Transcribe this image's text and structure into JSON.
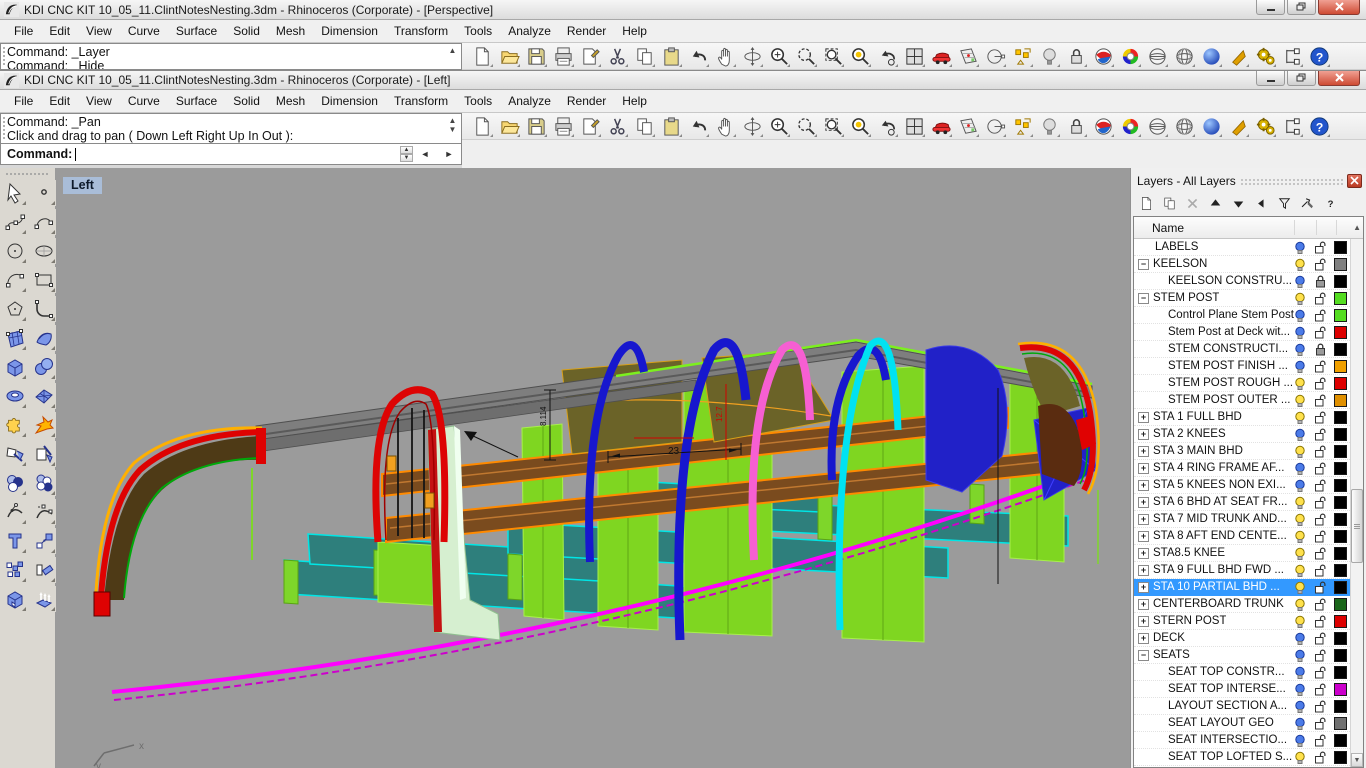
{
  "window1": {
    "title": "KDI CNC KIT 10_05_11.ClintNotesNesting.3dm - Rhinoceros (Corporate) - [Perspective]",
    "menus": [
      "File",
      "Edit",
      "View",
      "Curve",
      "Surface",
      "Solid",
      "Mesh",
      "Dimension",
      "Transform",
      "Tools",
      "Analyze",
      "Render",
      "Help"
    ],
    "command_history": [
      "Command: _Layer",
      "Command: _Hide"
    ]
  },
  "window2": {
    "title": "KDI CNC KIT 10_05_11.ClintNotesNesting.3dm - Rhinoceros (Corporate) - [Left]",
    "menus": [
      "File",
      "Edit",
      "View",
      "Curve",
      "Surface",
      "Solid",
      "Mesh",
      "Dimension",
      "Transform",
      "Tools",
      "Analyze",
      "Render",
      "Help"
    ],
    "command_history": [
      "Command: _Pan",
      "Click and drag to pan ( Down  Left  Right  Up  In  Out ):"
    ],
    "prompt_label": "Command:",
    "prompt_value": ""
  },
  "toolbar": {
    "icons": [
      {
        "name": "new-file",
        "label": "New"
      },
      {
        "name": "open-file",
        "label": "Open"
      },
      {
        "name": "save-file",
        "label": "Save"
      },
      {
        "name": "print",
        "label": "Print"
      },
      {
        "name": "page-setup",
        "label": "Page Setup"
      },
      {
        "name": "cut",
        "label": "Cut"
      },
      {
        "name": "copy",
        "label": "Copy"
      },
      {
        "name": "paste",
        "label": "Paste"
      },
      {
        "name": "undo",
        "label": "Undo"
      },
      {
        "name": "pan-view",
        "label": "Pan"
      },
      {
        "name": "rotate-view",
        "label": "Rotate View"
      },
      {
        "name": "zoom-dynamic",
        "label": "Zoom Dynamic"
      },
      {
        "name": "zoom-window",
        "label": "Zoom Window"
      },
      {
        "name": "zoom-target",
        "label": "Zoom Target"
      },
      {
        "name": "zoom-extents",
        "label": "Zoom Extents"
      },
      {
        "name": "undo-view",
        "label": "Undo View Change"
      },
      {
        "name": "viewport-layout",
        "label": "4 Viewports"
      },
      {
        "name": "car",
        "label": "Named View"
      },
      {
        "name": "cplane-map",
        "label": "CPlane Map"
      },
      {
        "name": "cplane-circle",
        "label": "Set CPlane"
      },
      {
        "name": "osnap",
        "label": "Object Snap"
      },
      {
        "name": "lamp",
        "label": "Lamp"
      },
      {
        "name": "lock-objects",
        "label": "Lock"
      },
      {
        "name": "shade-badge",
        "label": "Shade"
      },
      {
        "name": "color-wheel",
        "label": "Color"
      },
      {
        "name": "sphere-wireframe",
        "label": "Wireframe Display"
      },
      {
        "name": "sphere-lattice",
        "label": "Shaded Display"
      },
      {
        "name": "sphere-render",
        "label": "Render"
      },
      {
        "name": "spotlight-cone",
        "label": "Spotlight"
      },
      {
        "name": "options-gears",
        "label": "Options"
      },
      {
        "name": "dimension-tool",
        "label": "Dimension"
      },
      {
        "name": "help",
        "label": "Help"
      }
    ]
  },
  "left_toolbar": {
    "icons": [
      {
        "name": "select-pointer"
      },
      {
        "name": "point"
      },
      {
        "name": "control-point-curve"
      },
      {
        "name": "interpolate-curve"
      },
      {
        "name": "circle"
      },
      {
        "name": "ellipse"
      },
      {
        "name": "arc"
      },
      {
        "name": "rectangle"
      },
      {
        "name": "polygon"
      },
      {
        "name": "fillet-corner"
      },
      {
        "name": "surface-from-points"
      },
      {
        "name": "curved-surface"
      },
      {
        "name": "box"
      },
      {
        "name": "sphere"
      },
      {
        "name": "torus"
      },
      {
        "name": "surface-grid"
      },
      {
        "name": "join-puzzle"
      },
      {
        "name": "explode-burst"
      },
      {
        "name": "trim"
      },
      {
        "name": "split"
      },
      {
        "name": "boolean-union"
      },
      {
        "name": "boolean-difference"
      },
      {
        "name": "adjust-curve"
      },
      {
        "name": "rebuild-curve"
      },
      {
        "name": "text"
      },
      {
        "name": "scale"
      },
      {
        "name": "array"
      },
      {
        "name": "orient"
      },
      {
        "name": "solid-box"
      },
      {
        "name": "extrude-surface"
      }
    ]
  },
  "viewport": {
    "label": "Left",
    "axis_x": "x",
    "axis_y": "y",
    "annotations": {
      "dim_width": "23",
      "dim_height_black": "8.114",
      "dim_height_red": "12.7"
    }
  },
  "layers_panel": {
    "title": "Layers - All Layers",
    "name_header": "Name",
    "tools": [
      {
        "name": "new-layer"
      },
      {
        "name": "copy-layer"
      },
      {
        "name": "delete-layer"
      },
      {
        "name": "move-up"
      },
      {
        "name": "move-down"
      },
      {
        "name": "move-left"
      },
      {
        "name": "filter"
      },
      {
        "name": "layer-tools"
      },
      {
        "name": "panel-help"
      }
    ],
    "rows": [
      {
        "name": "LABELS",
        "level": 0,
        "toggle": "none",
        "bulb": "blue",
        "lock": "open",
        "color": "#000000",
        "selected": false
      },
      {
        "name": "KEELSON",
        "level": 0,
        "toggle": "minus",
        "bulb": "yellow",
        "lock": "open",
        "color": "#808080",
        "selected": false
      },
      {
        "name": "KEELSON CONSTRU...",
        "level": 1,
        "toggle": "none",
        "bulb": "blue",
        "lock": "closed",
        "color": "#000000",
        "selected": false
      },
      {
        "name": "STEM POST",
        "level": 0,
        "toggle": "minus",
        "bulb": "yellow",
        "lock": "open",
        "color": "#55dd22",
        "selected": false
      },
      {
        "name": "Control Plane Stem Post",
        "level": 1,
        "toggle": "none",
        "bulb": "blue",
        "lock": "open",
        "color": "#55dd22",
        "selected": false
      },
      {
        "name": "Stem Post at Deck wit...",
        "level": 1,
        "toggle": "none",
        "bulb": "blue",
        "lock": "open",
        "color": "#dd0000",
        "selected": false
      },
      {
        "name": "STEM CONSTRUCTI...",
        "level": 1,
        "toggle": "none",
        "bulb": "blue",
        "lock": "closed",
        "color": "#000000",
        "selected": false
      },
      {
        "name": "STEM POST FINISH ...",
        "level": 1,
        "toggle": "none",
        "bulb": "blue",
        "lock": "open",
        "color": "#f0a000",
        "selected": false
      },
      {
        "name": "STEM POST ROUGH ...",
        "level": 1,
        "toggle": "none",
        "bulb": "yellow",
        "lock": "open",
        "color": "#dd0000",
        "selected": false
      },
      {
        "name": "STEM POST OUTER ...",
        "level": 1,
        "toggle": "none",
        "bulb": "yellow",
        "lock": "open",
        "color": "#e09000",
        "selected": false
      },
      {
        "name": "STA 1 FULL BHD",
        "level": 0,
        "toggle": "plus",
        "bulb": "yellow",
        "lock": "open",
        "color": "#000000",
        "selected": false
      },
      {
        "name": "STA 2 KNEES",
        "level": 0,
        "toggle": "plus",
        "bulb": "blue",
        "lock": "open",
        "color": "#000000",
        "selected": false
      },
      {
        "name": "STA 3 MAIN BHD",
        "level": 0,
        "toggle": "plus",
        "bulb": "yellow",
        "lock": "open",
        "color": "#000000",
        "selected": false
      },
      {
        "name": "STA 4 RING FRAME AF...",
        "level": 0,
        "toggle": "plus",
        "bulb": "blue",
        "lock": "open",
        "color": "#000000",
        "selected": false
      },
      {
        "name": "STA 5 KNEES NON EXI...",
        "level": 0,
        "toggle": "plus",
        "bulb": "blue",
        "lock": "open",
        "color": "#000000",
        "selected": false
      },
      {
        "name": "STA 6 BHD AT SEAT FR...",
        "level": 0,
        "toggle": "plus",
        "bulb": "yellow",
        "lock": "open",
        "color": "#000000",
        "selected": false
      },
      {
        "name": "STA 7 MID TRUNK AND...",
        "level": 0,
        "toggle": "plus",
        "bulb": "yellow",
        "lock": "open",
        "color": "#000000",
        "selected": false
      },
      {
        "name": "STA 8 AFT END CENTE...",
        "level": 0,
        "toggle": "plus",
        "bulb": "yellow",
        "lock": "open",
        "color": "#000000",
        "selected": false
      },
      {
        "name": "STA8.5 KNEE",
        "level": 0,
        "toggle": "plus",
        "bulb": "yellow",
        "lock": "open",
        "color": "#000000",
        "selected": false
      },
      {
        "name": "STA 9 FULL BHD FWD ...",
        "level": 0,
        "toggle": "plus",
        "bulb": "yellow",
        "lock": "open",
        "color": "#000000",
        "selected": false
      },
      {
        "name": "STA 10 PARTIAL BHD ...",
        "level": 0,
        "toggle": "plus",
        "bulb": "yellow",
        "lock": "open",
        "color": "#000000",
        "selected": true
      },
      {
        "name": "CENTERBOARD TRUNK",
        "level": 0,
        "toggle": "plus",
        "bulb": "yellow",
        "lock": "open",
        "color": "#1a661a",
        "selected": false
      },
      {
        "name": "STERN POST",
        "level": 0,
        "toggle": "plus",
        "bulb": "yellow",
        "lock": "open",
        "color": "#dd0000",
        "selected": false
      },
      {
        "name": "DECK",
        "level": 0,
        "toggle": "plus",
        "bulb": "blue",
        "lock": "open",
        "color": "#000000",
        "selected": false
      },
      {
        "name": "SEATS",
        "level": 0,
        "toggle": "minus",
        "bulb": "blue",
        "lock": "open",
        "color": "#000000",
        "selected": false
      },
      {
        "name": "SEAT TOP CONSTR...",
        "level": 1,
        "toggle": "none",
        "bulb": "blue",
        "lock": "open",
        "color": "#000000",
        "selected": false
      },
      {
        "name": "SEAT TOP INTERSE...",
        "level": 1,
        "toggle": "none",
        "bulb": "blue",
        "lock": "open",
        "color": "#cc00cc",
        "selected": false
      },
      {
        "name": "LAYOUT SECTION A...",
        "level": 1,
        "toggle": "none",
        "bulb": "blue",
        "lock": "open",
        "color": "#000000",
        "selected": false
      },
      {
        "name": "SEAT LAYOUT GEO",
        "level": 1,
        "toggle": "none",
        "bulb": "blue",
        "lock": "open",
        "color": "#707070",
        "selected": false
      },
      {
        "name": "SEAT INTERSECTIO...",
        "level": 1,
        "toggle": "none",
        "bulb": "blue",
        "lock": "open",
        "color": "#000000",
        "selected": false
      },
      {
        "name": "SEAT TOP LOFTED S...",
        "level": 1,
        "toggle": "none",
        "bulb": "yellow",
        "lock": "open",
        "color": "#000000",
        "selected": false
      }
    ]
  },
  "colors": {
    "viewport_bg": "#9b9b9b",
    "selection_highlight": "#3399ff",
    "frame_green": "#7fd621",
    "frame_blue": "#1717ce",
    "frame_red": "#dd0404",
    "frame_pink": "#f65fd2",
    "frame_cyan": "#00e2f2",
    "chine_magenta": "#ff00ff",
    "keel_teal": "#2e7f7c",
    "stringer_orange": "#ff8a00",
    "sheer_gray": "#7e7e7e",
    "seat_olive": "#6b6328"
  }
}
